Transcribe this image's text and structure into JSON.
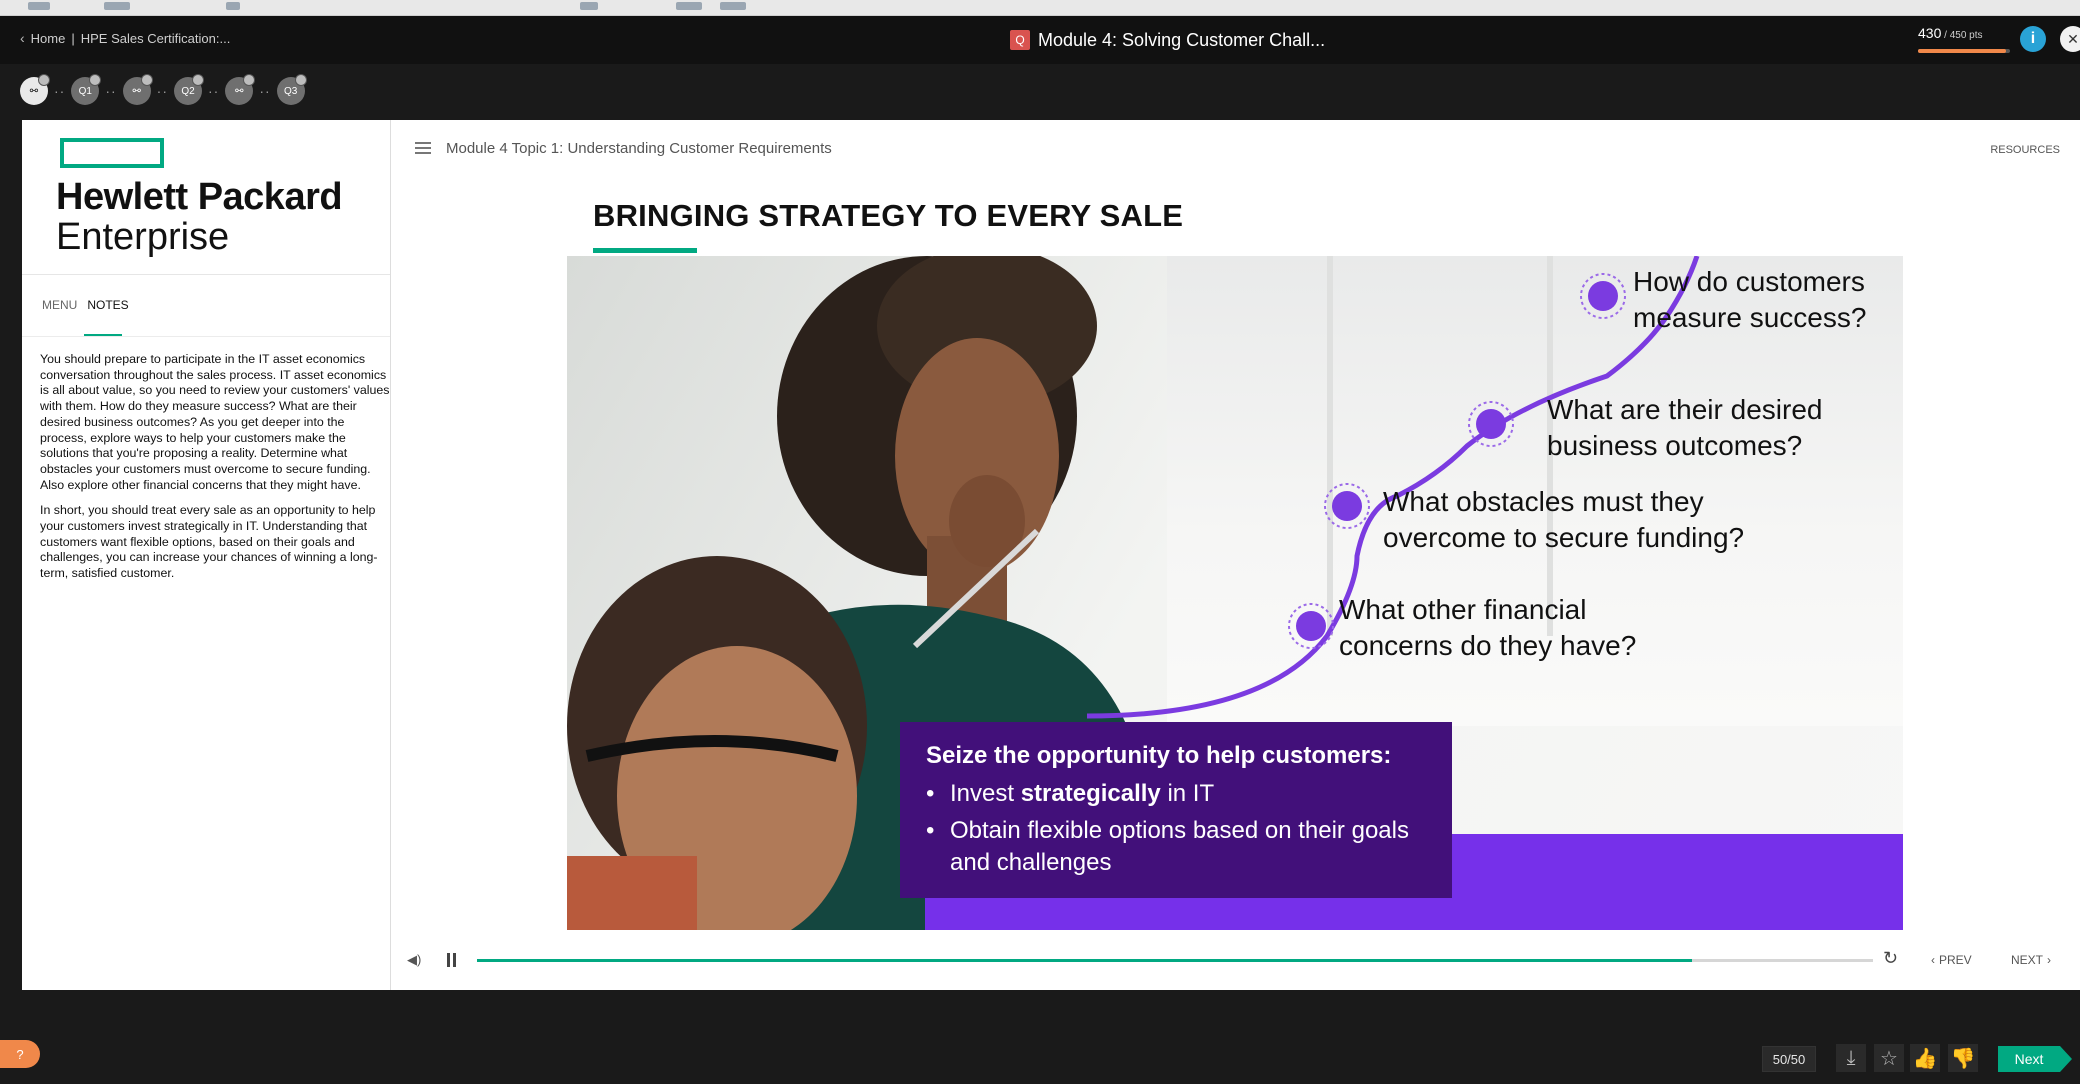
{
  "header": {
    "home_label": "Home",
    "course_label": "HPE Sales Certification:...",
    "module_badge": "Q",
    "module_title": "Module 4: Solving Customer Chall...",
    "points_value": "430",
    "points_suffix": " / 450 pts",
    "points_progress": 0.955
  },
  "progress_nodes": [
    {
      "label": "⚯",
      "state": "active"
    },
    {
      "label": "Q1",
      "state": "inactive"
    },
    {
      "label": "⚯",
      "state": "inactive"
    },
    {
      "label": "Q2",
      "state": "inactive"
    },
    {
      "label": "⚯",
      "state": "inactive"
    },
    {
      "label": "Q3",
      "state": "inactive"
    }
  ],
  "left_panel": {
    "logo_line1": "Hewlett Packard",
    "logo_line2": "Enterprise",
    "tab_menu": "MENU",
    "tab_notes": "NOTES",
    "notes_p1": "You should prepare to participate in the IT asset economics conversation throughout the sales process. IT asset economics is all about value, so you need to review your customers' values with them. How do they measure success? What are their desired business outcomes? As you get deeper into the process, explore ways to help your customers make the solutions that you're proposing a reality. Determine what obstacles your customers must overcome to secure funding. Also explore other financial concerns that they might have.",
    "notes_p2": "In short, you should treat every sale as an opportunity to help your customers invest strategically in IT. Understanding that customers want flexible options, based on their goals and challenges, you can increase your chances of winning a long-term, satisfied customer."
  },
  "content": {
    "topic_title": "Module 4 Topic 1: Understanding Customer Requirements",
    "resources_label": "RESOURCES",
    "slide_heading": "BRINGING STRATEGY TO EVERY SALE",
    "questions": [
      {
        "line1": "How do customers",
        "line2": "measure success?"
      },
      {
        "line1": "What are their desired",
        "line2": "business outcomes?"
      },
      {
        "line1": "What obstacles must they",
        "line2": "overcome to secure funding?"
      },
      {
        "line1": "What other financial",
        "line2": "concerns do they have?"
      }
    ],
    "callout_title": "Seize the opportunity to help customers:",
    "bullet1_pre": "Invest ",
    "bullet1_bold": "strategically",
    "bullet1_post": " in IT",
    "bullet2": "Obtain flexible options based on their goals and challenges"
  },
  "player": {
    "progress": 0.87,
    "prev_label": "PREV",
    "next_label": "NEXT"
  },
  "bottom_bar": {
    "page_count": "50/50",
    "next_label": "Next"
  },
  "colors": {
    "hpe_green": "#01a982",
    "purple_dark": "#42107a",
    "purple_bright": "#7630ea",
    "points_orange": "#f0884a",
    "info_blue": "#29a3d6"
  }
}
